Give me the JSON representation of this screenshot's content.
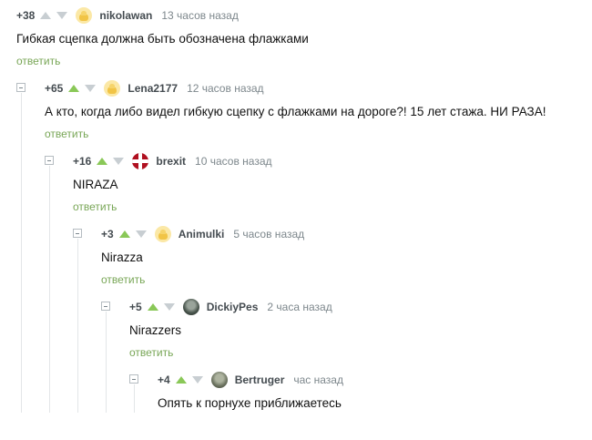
{
  "comments": [
    {
      "rating": "+38",
      "author": "nikolawan",
      "time": "13 часов назад",
      "avatar": "default-avatar-icon",
      "text": "Гибкая сцепка должна быть обозначена флажками",
      "reply": "ответить"
    },
    {
      "rating": "+65",
      "author": "Lena2177",
      "time": "12 часов назад",
      "avatar": "default-avatar-icon",
      "text": "А кто, когда либо видел гибкую сцепку с флажками на дороге?! 15 лет стажа. НИ РАЗА!",
      "reply": "ответить"
    },
    {
      "rating": "+16",
      "author": "brexit",
      "time": "10 часов назад",
      "avatar": "union-jack-avatar",
      "text": "NIRAZA",
      "reply": "ответить"
    },
    {
      "rating": "+3",
      "author": "Animulki",
      "time": "5 часов назад",
      "avatar": "default-avatar-icon",
      "text": "Nirazza",
      "reply": "ответить"
    },
    {
      "rating": "+5",
      "author": "DickiyPes",
      "time": "2 часа назад",
      "avatar": "photo-avatar",
      "text": "Nirazzers",
      "reply": "ответить"
    },
    {
      "rating": "+4",
      "author": "Bertruger",
      "time": "час назад",
      "avatar": "photo-avatar",
      "text": "Опять к порнухе приближаетесь",
      "reply": ""
    }
  ],
  "colors": {
    "upvote": "#8ac858",
    "downvote": "#c8ced2",
    "reply_link": "#78a656",
    "thread_line": "#e3e6e8"
  }
}
